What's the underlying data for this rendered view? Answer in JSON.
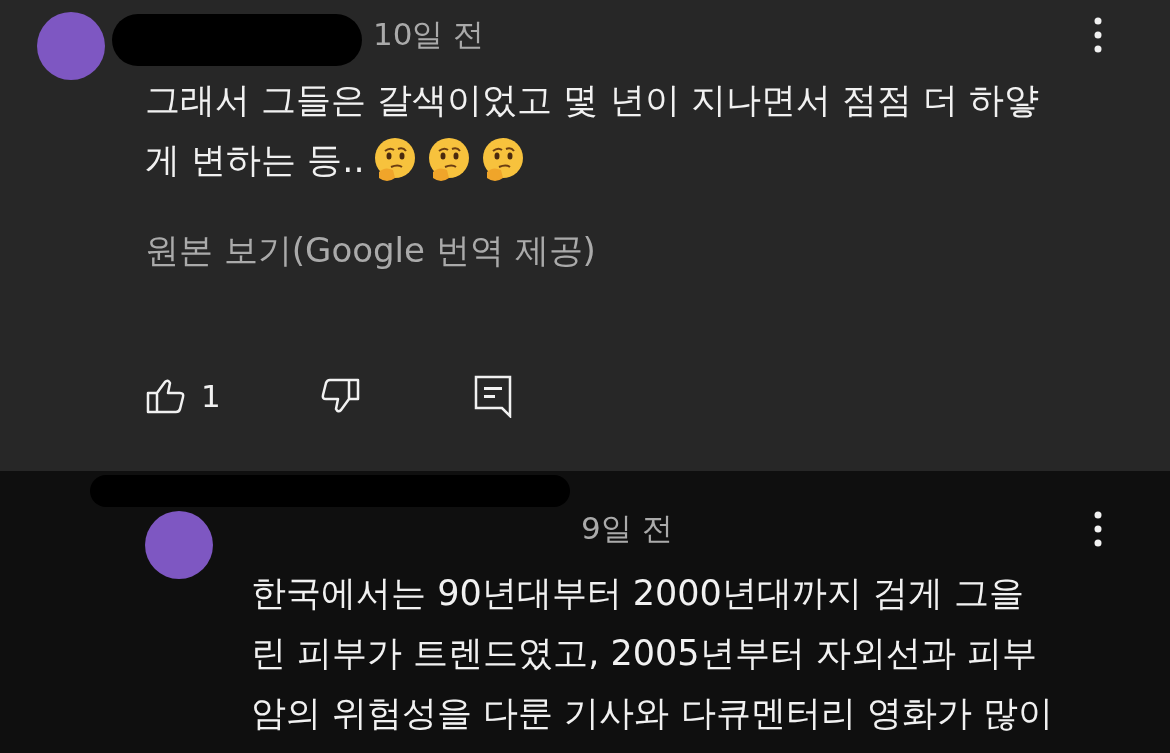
{
  "comments": [
    {
      "kind": "top",
      "time": "10일 전",
      "lines": [
        "그래서 그들은 갈색이었고 몇 년이 지나면서 점점 더 하얗",
        "게 변하는 등.."
      ],
      "trailing_icons": [
        {
          "kind": "thinking"
        },
        {
          "kind": "thinking"
        },
        {
          "kind": "thinking"
        }
      ],
      "translate_link": "원본 보기(Google 번역 제공)",
      "likes": "1"
    },
    {
      "kind": "reply",
      "time": "9일 전",
      "lines": [
        "한국에서는 90년대부터 2000년대까지 검게 그을",
        "린 피부가 트렌드였고, 2005년부터 자외선과 피부",
        "암의 위험성을 다룬 기사와 다큐멘터리 영화가 많이"
      ]
    }
  ]
}
